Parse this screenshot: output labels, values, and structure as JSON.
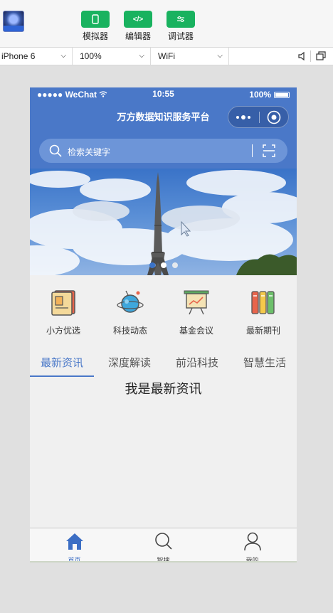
{
  "toolbar": {
    "tools": [
      {
        "label": "模拟器",
        "icon": "phone-icon"
      },
      {
        "label": "编辑器",
        "icon": "code-icon"
      },
      {
        "label": "调试器",
        "icon": "debug-icon"
      }
    ]
  },
  "device_bar": {
    "device": "iPhone 6",
    "zoom": "100%",
    "network": "WiFi"
  },
  "status_bar": {
    "carrier": "●●●●● WeChat",
    "time": "10:55",
    "battery": "100%"
  },
  "nav": {
    "title": "万方数据知识服务平台"
  },
  "search": {
    "placeholder": "检索关键字"
  },
  "banner": {
    "slides": 3,
    "active_slide": 0
  },
  "grid": [
    {
      "label": "小方优选",
      "icon": "book-icon"
    },
    {
      "label": "科技动态",
      "icon": "planet-icon"
    },
    {
      "label": "基金会议",
      "icon": "presentation-icon"
    },
    {
      "label": "最新期刊",
      "icon": "journals-icon"
    }
  ],
  "tabs": [
    {
      "label": "最新资讯",
      "active": true
    },
    {
      "label": "深度解读",
      "active": false
    },
    {
      "label": "前沿科技",
      "active": false
    },
    {
      "label": "智慧生活",
      "active": false
    }
  ],
  "content": {
    "text": "我是最新资讯"
  },
  "tabbar": [
    {
      "label": "首页",
      "icon": "home-icon",
      "active": true
    },
    {
      "label": "智搜",
      "icon": "search-icon",
      "active": false
    },
    {
      "label": "我的",
      "icon": "user-icon",
      "active": false
    }
  ],
  "colors": {
    "accent": "#4a78c8",
    "tool_green": "#19b25f"
  }
}
